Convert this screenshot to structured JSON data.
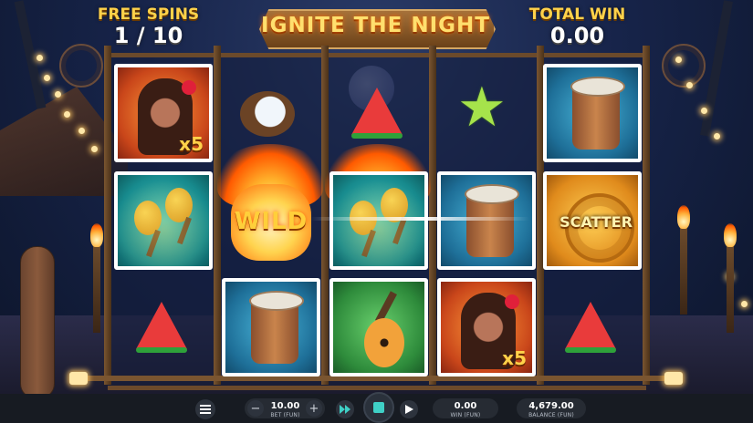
{
  "header": {
    "free_spins_label": "FREE SPINS",
    "free_spins_value": "1 / 10",
    "logo_text": "IGNITE THE NIGHT",
    "total_win_label": "TOTAL WIN",
    "total_win_value": "0.00"
  },
  "reels": [
    [
      "woman",
      "maracas",
      "melon"
    ],
    [
      "coconut",
      "wild-lantern",
      "drum"
    ],
    [
      "melon",
      "maracas",
      "guitar"
    ],
    [
      "starfruit",
      "drum",
      "woman"
    ],
    [
      "drum",
      "scatter",
      "melon"
    ]
  ],
  "symbols": {
    "wild_text": "WILD",
    "scatter_text": "SCATTER",
    "multiplier_1": "x5",
    "multiplier_2": "x5"
  },
  "controls": {
    "bet_value": "10.00",
    "bet_label": "BET (FUN)",
    "win_value": "0.00",
    "win_label": "WIN (FUN)",
    "balance_value": "4,679.00",
    "balance_label": "BALANCE (FUN)",
    "minus": "−",
    "plus": "+"
  },
  "colors": {
    "accent_gold": "#ffd24a",
    "bar_bg": "#171b22"
  }
}
